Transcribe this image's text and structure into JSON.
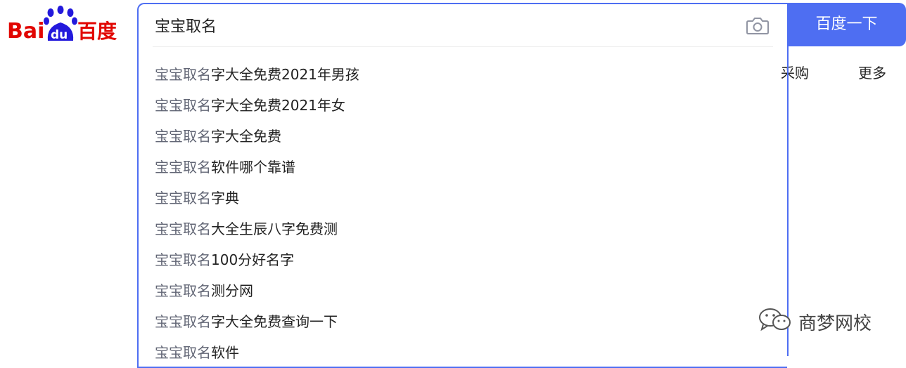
{
  "logo": {
    "text_bai": "Bai",
    "text_du": "du",
    "text_cn": "百度"
  },
  "search": {
    "value": "宝宝取名",
    "button_label": "百度一下"
  },
  "suggestions": [
    {
      "prefix": "宝宝取名",
      "rest": "字大全免费2021年男孩"
    },
    {
      "prefix": "宝宝取名",
      "rest": "字大全免费2021年女"
    },
    {
      "prefix": "宝宝取名",
      "rest": "字大全免费"
    },
    {
      "prefix": "宝宝取名",
      "rest": "软件哪个靠谱"
    },
    {
      "prefix": "宝宝取名",
      "rest": "字典"
    },
    {
      "prefix": "宝宝取名",
      "rest": "大全生辰八字免费测"
    },
    {
      "prefix": "宝宝取名",
      "rest": "100分好名字"
    },
    {
      "prefix": "宝宝取名",
      "rest": "测分网"
    },
    {
      "prefix": "宝宝取名",
      "rest": "字大全免费查询一下"
    },
    {
      "prefix": "宝宝取名",
      "rest": "软件"
    }
  ],
  "nav": {
    "caigou": "采购",
    "more": "更多"
  },
  "watermark": {
    "text": "商梦网校"
  },
  "colors": {
    "brand_blue": "#4e6ef2",
    "baidu_red": "#e10602",
    "baidu_blue": "#2319dc",
    "suggestion_prefix": "#626675"
  },
  "icons": {
    "camera": "camera-icon",
    "wechat": "wechat-icon"
  }
}
